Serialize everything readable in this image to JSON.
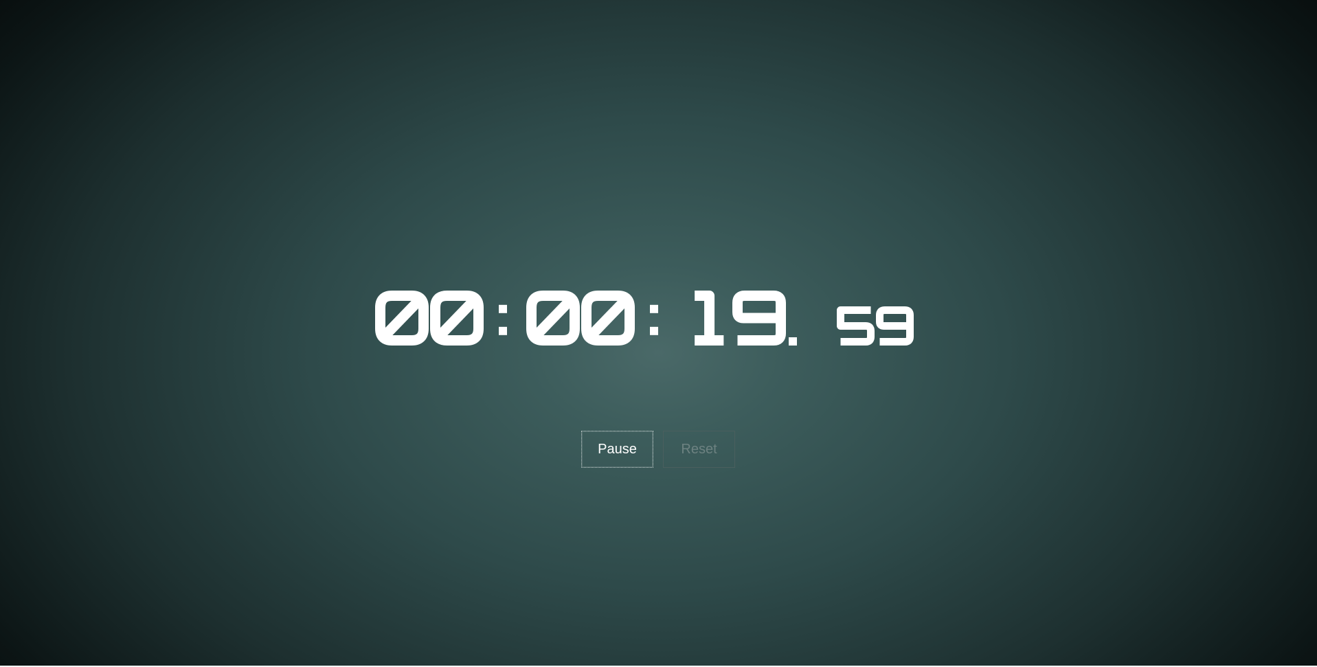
{
  "timer": {
    "hours": "00",
    "minutes": "00",
    "seconds": "19",
    "hundredths": "59",
    "separator": ":",
    "decimal": "."
  },
  "controls": {
    "pause_label": "Pause",
    "reset_label": "Reset",
    "reset_enabled": false
  },
  "colors": {
    "digit": "#ffffff",
    "background_center": "#4a6968",
    "background_edge": "#070c0c"
  }
}
